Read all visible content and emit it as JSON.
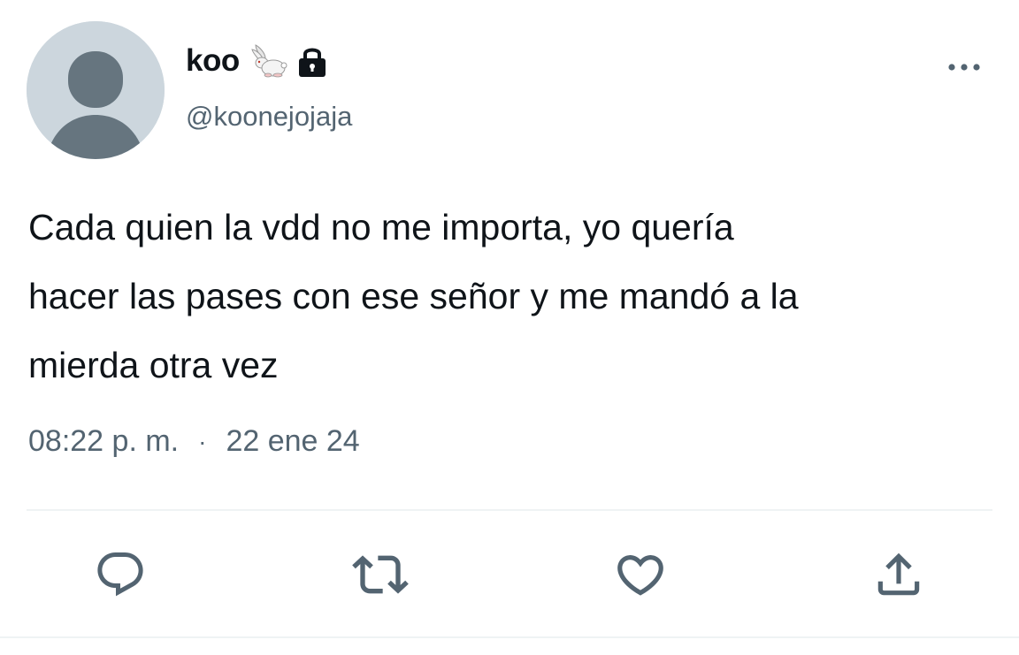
{
  "tweet": {
    "display_name": "koo",
    "name_emoji": "rabbit",
    "protected_icon": "lock-icon",
    "handle": "@koonejojaja",
    "text_lines": [
      "Cada quien la vdd no me importa, yo quería",
      "hacer las pases con ese señor y me mandó a la",
      "mierda otra vez"
    ],
    "time": "08:22 p. m.",
    "separator": "·",
    "date": "22 ene 24"
  },
  "actions": [
    {
      "icon": "reply-icon"
    },
    {
      "icon": "retweet-icon"
    },
    {
      "icon": "like-icon"
    },
    {
      "icon": "share-icon"
    }
  ],
  "colors": {
    "text": "#0f1419",
    "secondary": "#536471",
    "avatar_bg": "#ccd6dd",
    "avatar_fg": "#66757f",
    "divider": "#eff3f4"
  }
}
